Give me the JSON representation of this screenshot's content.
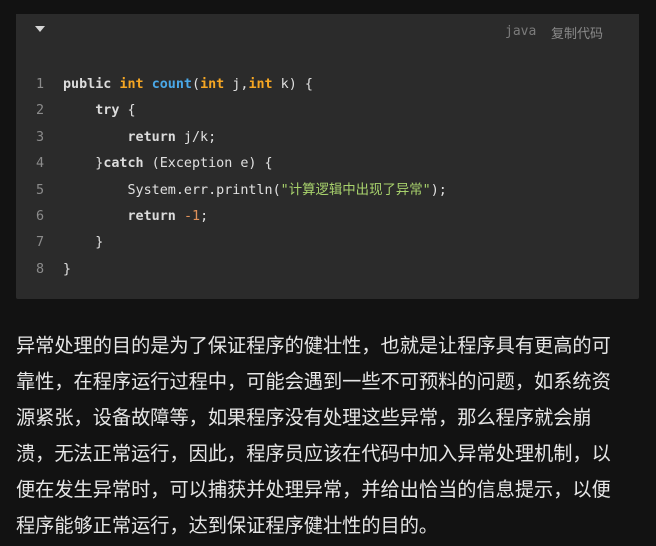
{
  "code_block": {
    "language": "java",
    "copy_label": "复制代码",
    "lines": [
      {
        "num": "1",
        "tokens": [
          {
            "t": "public ",
            "c": "kw"
          },
          {
            "t": "int ",
            "c": "type"
          },
          {
            "t": "count",
            "c": "fn"
          },
          {
            "t": "(",
            "c": "plain"
          },
          {
            "t": "int",
            "c": "type"
          },
          {
            "t": " j,",
            "c": "plain"
          },
          {
            "t": "int",
            "c": "type"
          },
          {
            "t": " k) {",
            "c": "plain"
          }
        ]
      },
      {
        "num": "2",
        "tokens": [
          {
            "t": "    ",
            "c": "plain"
          },
          {
            "t": "try",
            "c": "kw"
          },
          {
            "t": " {",
            "c": "plain"
          }
        ]
      },
      {
        "num": "3",
        "tokens": [
          {
            "t": "        ",
            "c": "plain"
          },
          {
            "t": "return",
            "c": "kw"
          },
          {
            "t": " j/k;",
            "c": "plain"
          }
        ]
      },
      {
        "num": "4",
        "tokens": [
          {
            "t": "    }",
            "c": "plain"
          },
          {
            "t": "catch",
            "c": "kw"
          },
          {
            "t": " (Exception e) {",
            "c": "plain"
          }
        ]
      },
      {
        "num": "5",
        "tokens": [
          {
            "t": "        System.err.println(",
            "c": "plain"
          },
          {
            "t": "\"计算逻辑中出现了异常\"",
            "c": "str"
          },
          {
            "t": ");",
            "c": "plain"
          }
        ]
      },
      {
        "num": "6",
        "tokens": [
          {
            "t": "        ",
            "c": "plain"
          },
          {
            "t": "return",
            "c": "kw"
          },
          {
            "t": " ",
            "c": "plain"
          },
          {
            "t": "-1",
            "c": "num"
          },
          {
            "t": ";",
            "c": "plain"
          }
        ]
      },
      {
        "num": "7",
        "tokens": [
          {
            "t": "    }",
            "c": "plain"
          }
        ]
      },
      {
        "num": "8",
        "tokens": [
          {
            "t": "}",
            "c": "plain"
          }
        ]
      }
    ]
  },
  "paragraph": {
    "lines": [
      "异常处理的目的是为了保证程序的健壮性，也就是让程序具有更高的可",
      "靠性，在程序运行过程中，可能会遇到一些不可预料的问题，如系统资",
      "源紧张，设备故障等，如果程序没有处理这些异常，那么程序就会崩",
      "溃，无法正常运行，因此，程序员应该在代码中加入异常处理机制，以",
      "便在发生异常时，可以捕获并处理异常，并给出恰当的信息提示，以便",
      "程序能够正常运行，达到保证程序健壮性的目的。"
    ]
  }
}
